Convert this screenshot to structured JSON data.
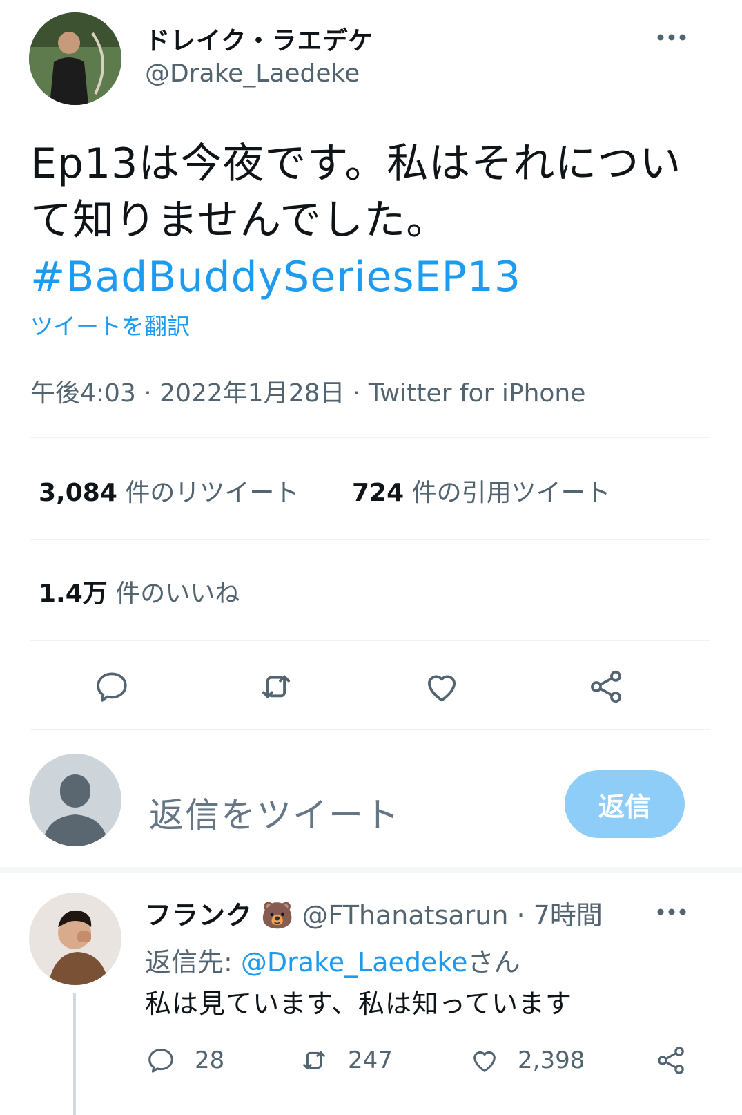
{
  "tweet": {
    "display_name": "ドレイク・ラエデケ",
    "handle": "@Drake_Laedeke",
    "text": "Ep13は今夜です。私はそれについて知りませんでした。",
    "hashtag": "#BadBuddySeriesEP13",
    "translate_label": "ツイートを翻訳",
    "meta": "午後4:03 · 2022年1月28日 · Twitter for iPhone",
    "more_icon": "more-horizontal-icon"
  },
  "stats": {
    "retweets_count": "3,084",
    "retweets_label": "件のリツイート",
    "quotes_count": "724",
    "quotes_label": "件の引用ツイート",
    "likes_count": "1.4万",
    "likes_label": "件のいいね"
  },
  "actions": [
    "reply-icon",
    "retweet-icon",
    "like-icon",
    "share-icon"
  ],
  "compose": {
    "placeholder": "返信をツイート",
    "reply_button": "返信"
  },
  "reply": {
    "display_name": "フランク",
    "emoji": "🐻",
    "handle": "@FThanatsarun",
    "time": "· 7時間",
    "reply_to_prefix": "返信先: ",
    "reply_to_handle": "@Drake_Laedeke",
    "reply_to_suffix": "さん",
    "text": "私は見ています、私は知っています",
    "reply_count": "28",
    "retweet_count": "247",
    "like_count": "2,398"
  },
  "colors": {
    "accent": "#1d9bf0",
    "reply_button_bg": "#8ecdf7",
    "muted_text": "#536471",
    "divider": "#eff3f4"
  }
}
